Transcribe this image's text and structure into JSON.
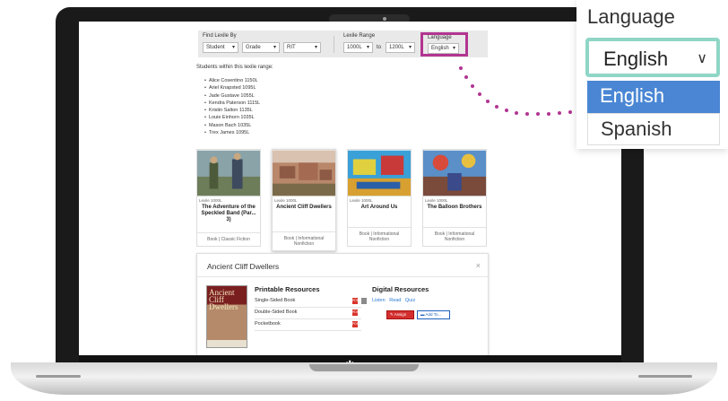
{
  "filters": {
    "find_label": "Find Lexile By",
    "find_options": [
      "Student",
      "Grade",
      "RIT"
    ],
    "range_label": "Lexile Range",
    "range_from": "1000L",
    "range_to_word": "to",
    "range_to": "1200L",
    "language_label": "Language",
    "language_value": "English"
  },
  "students_heading": "Students within this lexile range:",
  "students": [
    "Alice Cosentino 1150L",
    "Ariel Knapsted 1095L",
    "Jade Gustave 1055L",
    "Kendra Paterson 1115L",
    "Kristin Salton 1135L",
    "Louie Einhorn 1035L",
    "Mason Bach 1035L",
    "Trex James 1095L"
  ],
  "books": [
    {
      "lexile": "Lexile 1000L",
      "title": "The Adventure of the Speckled Band (Par... 3)",
      "type": "Book | Classic Fiction"
    },
    {
      "lexile": "Lexile 1000L",
      "title": "Ancient Cliff Dwellers",
      "type": "Book | Informational Nonfiction"
    },
    {
      "lexile": "Lexile 1000L",
      "title": "Art Around Us",
      "type": "Book | Informational Nonfiction"
    },
    {
      "lexile": "Lexile 1000L",
      "title": "The Balloon Brothers",
      "type": "Book | Informational Nonfiction"
    }
  ],
  "detail": {
    "title": "Ancient Cliff Dwellers",
    "close": "×",
    "cover_title": "Ancient Cliff Dwellers",
    "printable_heading": "Printable Resources",
    "printable": [
      "Single-Sided Book",
      "Double-Sided Book",
      "Pocketbook"
    ],
    "digital_heading": "Digital Resources",
    "digital_links": [
      "Listen",
      "Read",
      "Quiz"
    ],
    "assign_label": "Assign",
    "add_label": "Add To..."
  },
  "zoom": {
    "label": "Language",
    "selected": "English",
    "options": [
      "English",
      "Spanish"
    ]
  },
  "device_nav": {
    "back": "⎗",
    "power": "⏻",
    "return": "↶"
  },
  "colors": {
    "highlight": "#b23591",
    "focus_ring": "#8fd6c6",
    "option_active": "#4a86d4"
  }
}
